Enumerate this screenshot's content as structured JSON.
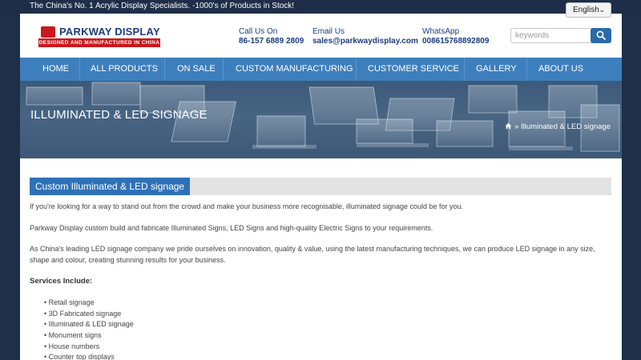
{
  "topbar": {
    "tagline": "The China's No. 1 Acrylic Display Specialists. -1000's of Products in Stock!",
    "language": "English"
  },
  "header": {
    "logo_title": "PARKWAY DISPLAY",
    "logo_subtitle": "DESIGNED AND MANUFACTURED IN CHINA",
    "call_label": "Call Us On",
    "call_value": "86-157 6889 2809",
    "email_label": "Email Us",
    "email_value": "sales@parkwaydisplay.com",
    "whatsapp_label": "WhatsApp",
    "whatsapp_value": "008615768892809",
    "search_placeholder": "keywords"
  },
  "nav": {
    "items": [
      "HOME",
      "ALL PRODUCTS",
      "ON SALE",
      "CUSTOM MANUFACTURING",
      "CUSTOMER SERVICE",
      "GALLERY",
      "ABOUT US"
    ]
  },
  "banner": {
    "title": "ILLUMINATED & LED SIGNAGE",
    "breadcrumb": "» Illuminated & LED signage"
  },
  "content": {
    "heading": "Custom Illuminated & LED signage",
    "p1": "If you're looking for a way to stand out from the crowd and make your business more recognisable, illuminated signage could be for you.",
    "p2": "Parkway Display custom build and fabricate Illuminated Signs, LED Signs and high-quality Electric Signs to your requirements.",
    "p3": "As China's leading LED signage company we pride ourselves on innovation, quality & value, using the latest manufacturing techniques, we can produce LED signage in any size, shape and colour, creating stunning results for your business.",
    "services_title": "Services Include:",
    "services": [
      "Retail signage",
      "3D Fabricated signage",
      "Illuminated & LED signage",
      "Monument signs",
      "House numbers",
      "Counter top displays"
    ]
  },
  "colors": {
    "nav": "#3d7fbd",
    "accent_blue": "#2f71b7",
    "logo_red": "#c9191e",
    "dark_bg": "#1f2f4a"
  },
  "icons": {
    "search": "search-icon",
    "home": "home-icon",
    "language_dropdown": "chevron-down-icon"
  }
}
